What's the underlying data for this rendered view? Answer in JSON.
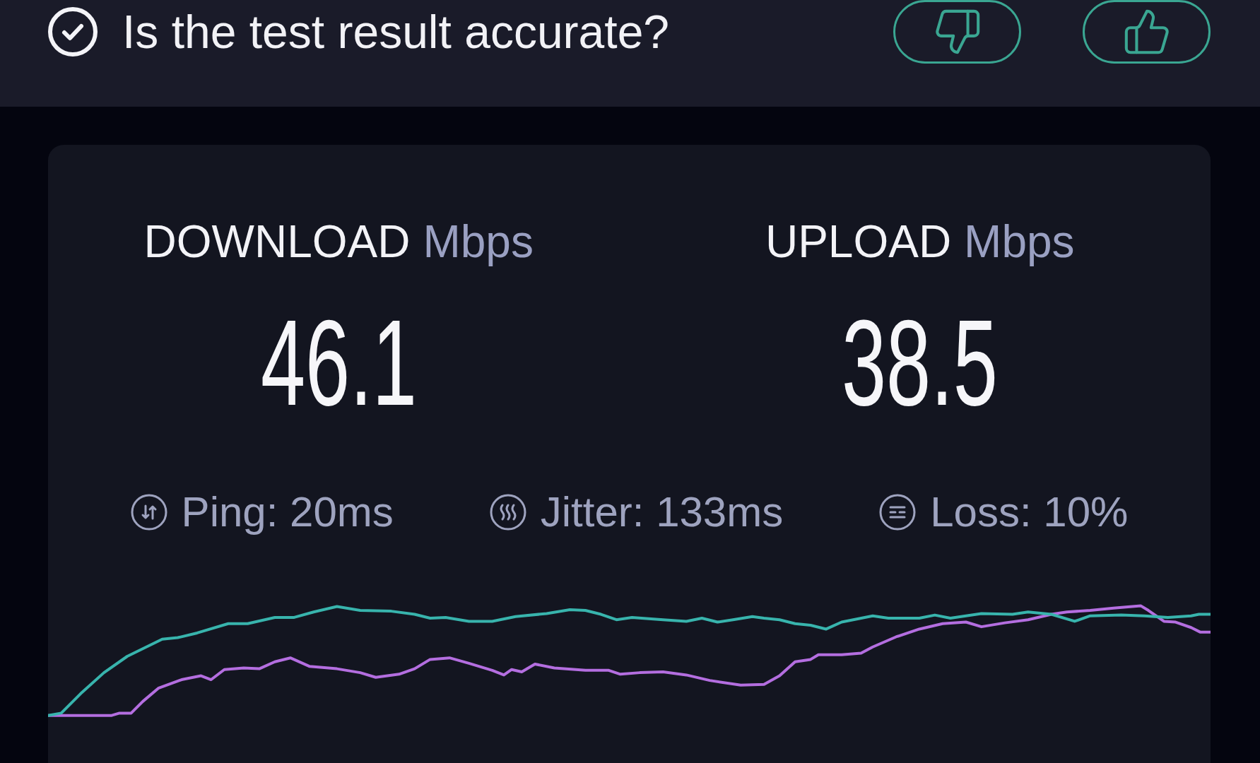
{
  "feedback": {
    "question": "Is the test result accurate?"
  },
  "results": [
    {
      "label": "DOWNLOAD",
      "unit": "Mbps",
      "value": "46.1"
    },
    {
      "label": "UPLOAD",
      "unit": "Mbps",
      "value": "38.5"
    }
  ],
  "metrics": [
    {
      "kind": "ping",
      "label": "Ping: 20ms"
    },
    {
      "kind": "jitter",
      "label": "Jitter: 133ms"
    },
    {
      "kind": "loss",
      "label": "Loss: 10%"
    }
  ]
}
